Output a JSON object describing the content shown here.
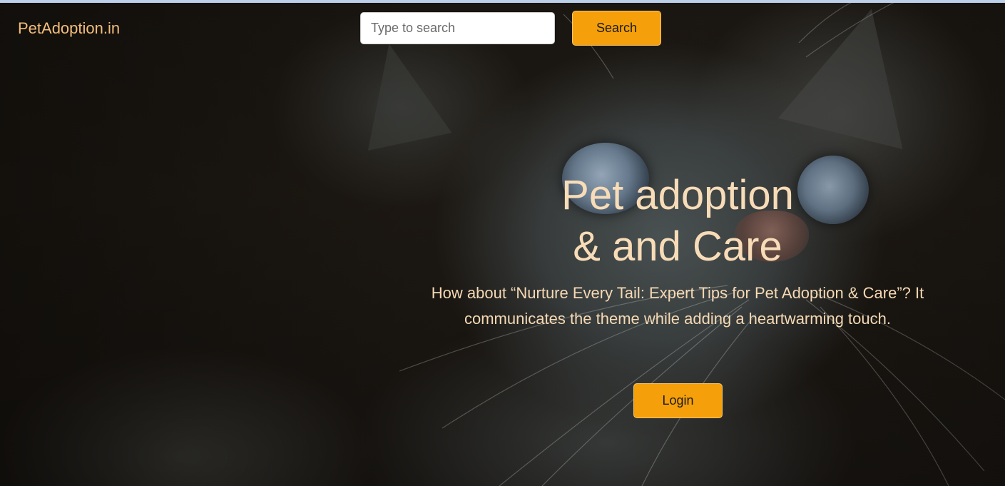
{
  "header": {
    "brand": "PetAdoption.in",
    "search": {
      "placeholder": "Type to search",
      "value": "",
      "button_label": "Search"
    }
  },
  "hero": {
    "title_line1": "Pet adoption",
    "title_line2": "& and Care",
    "subtitle": "How about “Nurture Every Tail: Expert Tips for Pet Adoption & Care”? It communicates the theme while adding a heartwarming touch.",
    "login_label": "Login",
    "background_image": "cat-closeup-photo"
  },
  "colors": {
    "accent": "#f5a00b",
    "brand_text": "#f3be7a",
    "hero_text": "#f8dcb8",
    "background": "#15110d"
  }
}
